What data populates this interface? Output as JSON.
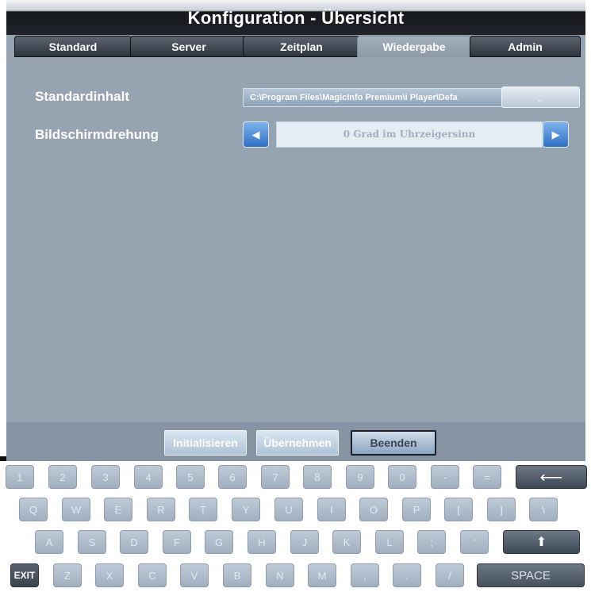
{
  "window": {
    "title": "Konfiguration - Übersicht"
  },
  "tabs": [
    {
      "label": "Standard",
      "active": false
    },
    {
      "label": "Server",
      "active": false
    },
    {
      "label": "Zeitplan",
      "active": false
    },
    {
      "label": "Wiedergabe",
      "active": true
    },
    {
      "label": "Admin",
      "active": false
    }
  ],
  "settings": {
    "default_content": {
      "label": "Standardinhalt",
      "value": "C:\\Program Files\\MagicInfo Premium\\i Player\\Defa",
      "browse_label": ".."
    },
    "screen_rotation": {
      "label": "Bildschirmdrehung",
      "value": "0 Grad im Uhrzeigersinn",
      "prev_icon": "arrow-left-icon",
      "next_icon": "arrow-right-icon"
    }
  },
  "actions": {
    "reset": "Initialisieren",
    "apply": "Übernehmen",
    "exit": "Beenden"
  },
  "keyboard": {
    "row1": [
      "1",
      "2",
      "3",
      "4",
      "5",
      "6",
      "7",
      "8",
      "9",
      "0",
      "-",
      "="
    ],
    "backspace": "⟵",
    "row2": [
      "Q",
      "W",
      "E",
      "R",
      "T",
      "Y",
      "U",
      "I",
      "O",
      "P",
      "[",
      "]",
      "\\"
    ],
    "row3": [
      "A",
      "S",
      "D",
      "F",
      "G",
      "H",
      "J",
      "K",
      "L",
      ";",
      "'"
    ],
    "shift": "⬆",
    "exit": "EXIT",
    "row4": [
      "Z",
      "X",
      "C",
      "V",
      "B",
      "N",
      "M",
      ",",
      ".",
      "/"
    ],
    "space": "SPACE"
  },
  "colors": {
    "accent": "#3a7bd5",
    "panel": "#96a3b1",
    "titlebar": "#1a1d22"
  }
}
